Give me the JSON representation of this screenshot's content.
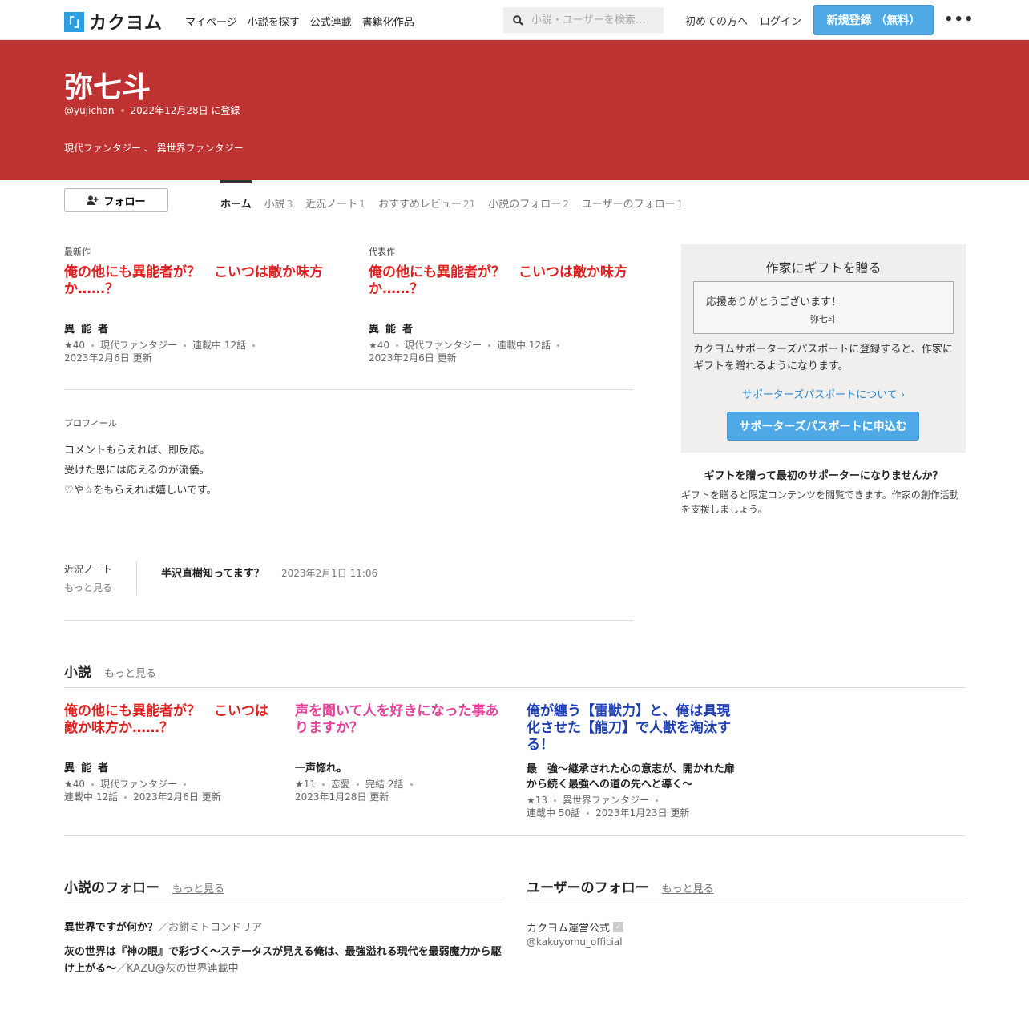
{
  "header": {
    "logo_text": "カクヨム",
    "logo_mark": "「」",
    "nav": [
      "マイページ",
      "小説を探す",
      "公式連載",
      "書籍化作品"
    ],
    "search_placeholder": "小説・ユーザーを検索…",
    "beginner_link": "初めての方へ",
    "login_link": "ログイン",
    "register_button": "新規登録 （無料）",
    "more_icon": "more-dots-icon",
    "brand_color": "#2d9ee0"
  },
  "banner": {
    "name": "弥七斗",
    "user_id": "@yujichan",
    "registered": "2022年12月28日 に登録",
    "genres": "現代ファンタジー 、 異世界ファンタジー",
    "color": "#bf3232"
  },
  "follow_button": "フォロー",
  "tabs": [
    {
      "label": "ホーム",
      "count": ""
    },
    {
      "label": "小説",
      "count": "3"
    },
    {
      "label": "近況ノート",
      "count": "1"
    },
    {
      "label": "おすすめレビュー",
      "count": "21"
    },
    {
      "label": "小説のフォロー",
      "count": "2"
    },
    {
      "label": "ユーザーのフォロー",
      "count": "1"
    }
  ],
  "latest": {
    "label": "最新作",
    "title": "俺の他にも異能者が？　こいつは敵か味方か……？",
    "catch": "異能者",
    "stars": "★40",
    "genre": "現代ファンタジー",
    "status": "連載中 12話",
    "updated": "2023年2月6日 更新"
  },
  "representative": {
    "label": "代表作",
    "title": "俺の他にも異能者が？　こいつは敵か味方か……？",
    "catch": "異能者",
    "stars": "★40",
    "genre": "現代ファンタジー",
    "status": "連載中 12話",
    "updated": "2023年2月6日 更新"
  },
  "profile": {
    "label": "プロフィール",
    "lines": [
      "コメントもらえれば、即反応。",
      "受けた恩には応えるのが流儀。",
      "♡や☆をもらえれば嬉しいです。"
    ]
  },
  "news": {
    "label": "近況ノート",
    "more": "もっと見る",
    "title": "半沢直樹知ってます？",
    "date": "2023年2月1日 11:06"
  },
  "gift": {
    "heading": "作家にギフトを贈る",
    "message": "応援ありがとうございます！",
    "signature": "弥七斗",
    "description": "カクヨムサポーターズパスポートに登録すると、作家にギフトを贈れるようになります。",
    "link": "サポーターズパスポートについて",
    "button": "サポーターズパスポートに申込む",
    "question": "ギフトを贈って最初のサポーターになりませんか？",
    "sub": "ギフトを贈ると限定コンテンツを閲覧できます。作家の創作活動を支援しましょう。"
  },
  "novels": {
    "heading": "小説",
    "more": "もっと見る",
    "items": [
      {
        "title": "俺の他にも異能者が？　こいつは敵か味方か……？",
        "catch": "異能者",
        "stars": "★40",
        "genre": "現代ファンタジー",
        "status": "連載中 12話",
        "updated": "2023年2月6日 更新",
        "color": "#e02020"
      },
      {
        "title": "声を聞いて人を好きになった事ありますか？",
        "catch": "一声惚れ。",
        "stars": "★11",
        "genre": "恋愛",
        "status": "完結 2話",
        "updated": "2023年1月28日 更新",
        "color": "#e8409a"
      },
      {
        "title": "俺が纏う【雷獣力】と、俺は具現化させた【龍刀】で人獣を淘汰する！",
        "catch": "最　強〜継承された心の意志が、開かれた扉から続く最強への道の先へと導く〜",
        "stars": "★13",
        "genre": "異世界ファンタジー",
        "status": "連載中 50話",
        "updated": "2023年1月23日 更新",
        "color": "#1f3fb5"
      }
    ]
  },
  "novel_follows": {
    "heading": "小説のフォロー",
    "more": "もっと見る",
    "items": [
      {
        "title": "異世界ですが何か？",
        "author": "／お餅ミトコンドリア"
      },
      {
        "title": "灰の世界は『神の眼』で彩づく～ステータスが見える俺は、最強溢れる現代を最弱魔力から駆け上がる～",
        "author": "／KAZU@灰の世界連載中"
      }
    ]
  },
  "user_follows": {
    "heading": "ユーザーのフォロー",
    "more": "もっと見る",
    "name": "カクヨム運営公式",
    "id": "@kakuyomu_official"
  }
}
